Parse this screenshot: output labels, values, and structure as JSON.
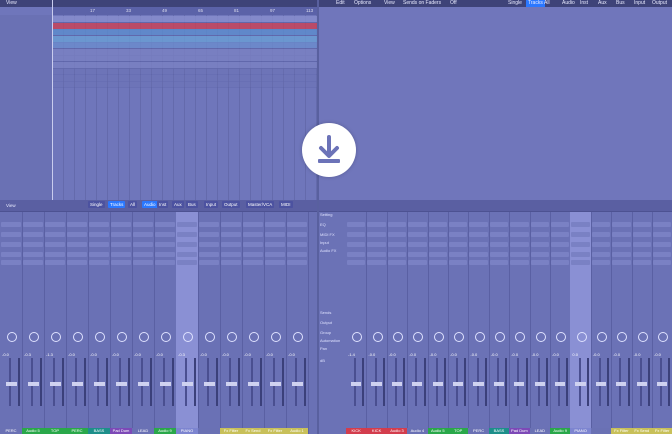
{
  "top_left": {
    "menu": {
      "view": "View"
    },
    "ruler": [
      "17",
      "33",
      "49",
      "65",
      "81",
      "97",
      "113"
    ],
    "track_rows": [
      {
        "color": "#8a90d0"
      },
      {
        "color": "#d33d4d"
      },
      {
        "color": "#5b8fd0"
      },
      {
        "color": "#6aa2d8"
      },
      {
        "color": "#6c8fd0"
      },
      {
        "color": "#7c83c4"
      },
      {
        "color": "#7c83c4"
      },
      {
        "color": "#7c83c4"
      },
      {
        "color": "#6a71b4"
      },
      {
        "color": "#6a71b4"
      },
      {
        "color": "#6a71b4"
      }
    ]
  },
  "top_right": {
    "menu": [
      "Edit",
      "Options",
      "View",
      "Sends on Faders",
      "Off"
    ],
    "filter": [
      "Single",
      "Tracks",
      "All",
      "Audio",
      "Inst",
      "Aux",
      "Bus",
      "Input",
      "Output"
    ]
  },
  "left_mixer": {
    "menu": {
      "view": "View"
    },
    "filter": [
      "Single",
      "Tracks",
      "All",
      "Audio",
      "Inst",
      "Aux",
      "Bus",
      "Input",
      "Output",
      "Master/VCA",
      "MIDI"
    ],
    "strips": [
      {
        "name": "PERC",
        "color": "#6a71b4",
        "sel": false,
        "fx": "Audio FX",
        "send": "-0.0"
      },
      {
        "name": "Audio 5",
        "color": "#2aa84a",
        "sel": false,
        "fx": "",
        "send": "-0.3"
      },
      {
        "name": "TOP",
        "color": "#2aa84a",
        "sel": false,
        "fx": "",
        "send": "-1.3"
      },
      {
        "name": "PERC",
        "color": "#2aa84a",
        "sel": false,
        "fx": "",
        "send": "-0.0"
      },
      {
        "name": "BASS",
        "color": "#1d8f8a",
        "sel": false,
        "fx": "",
        "send": "-0.0"
      },
      {
        "name": "Pad Dum",
        "color": "#7d49b7",
        "sel": false,
        "fx": "",
        "send": "-0.0"
      },
      {
        "name": "LEAD",
        "color": "#6a71b4",
        "sel": false,
        "fx": "",
        "send": "-0.0"
      },
      {
        "name": "Audio 9",
        "color": "#2aa84a",
        "sel": false,
        "fx": "",
        "send": "-0.0"
      },
      {
        "name": "PIANO",
        "color": "#7d85d0",
        "sel": true,
        "fx": "",
        "send": "-0.3"
      },
      {
        "name": "",
        "color": "#6a71b4",
        "sel": false,
        "fx": "",
        "send": "-0.0"
      },
      {
        "name": "Fx Filter",
        "color": "#c8c05a",
        "sel": false,
        "fx": "",
        "send": "-0.0"
      },
      {
        "name": "Fx Send",
        "color": "#c8c05a",
        "sel": false,
        "fx": "",
        "send": "-0.0"
      },
      {
        "name": "Fx Filter",
        "color": "#c8c05a",
        "sel": false,
        "fx": "",
        "send": "-0.0"
      },
      {
        "name": "Audio 1",
        "color": "#c8c05a",
        "sel": false,
        "fx": "",
        "send": "-0.0"
      }
    ]
  },
  "right_mixer": {
    "labels": [
      "Setting",
      "EQ",
      "MIDI FX",
      "Input",
      "Audio FX",
      "Sends",
      "Output",
      "Group",
      "Automation",
      "Pan",
      "dB"
    ],
    "strips": [
      {
        "name": "KICK",
        "color": "#d33d4d",
        "sel": false,
        "send": "-1.4"
      },
      {
        "name": "KICK",
        "color": "#d33d4d",
        "sel": false,
        "send": "-0.0"
      },
      {
        "name": "Audio 3",
        "color": "#d33d4d",
        "sel": false,
        "send": "-0.0"
      },
      {
        "name": "Audio 4",
        "color": "#6a71b4",
        "sel": false,
        "send": "-0.0"
      },
      {
        "name": "Audio 5",
        "color": "#2aa84a",
        "sel": false,
        "send": "-0.0"
      },
      {
        "name": "TOP",
        "color": "#2aa84a",
        "sel": false,
        "send": "-0.0"
      },
      {
        "name": "PERC",
        "color": "#6a71b4",
        "sel": false,
        "send": "-0.0"
      },
      {
        "name": "BASS",
        "color": "#1d8f8a",
        "sel": false,
        "send": "-0.0"
      },
      {
        "name": "Pad Dum",
        "color": "#7d49b7",
        "sel": false,
        "send": "-0.0"
      },
      {
        "name": "LEAD",
        "color": "#6a71b4",
        "sel": false,
        "send": "-0.0"
      },
      {
        "name": "Audio 9",
        "color": "#2aa84a",
        "sel": false,
        "send": "-0.0"
      },
      {
        "name": "PIANO",
        "color": "#7d85d0",
        "sel": true,
        "send": "0.0"
      },
      {
        "name": "",
        "color": "#6a71b4",
        "sel": false,
        "send": "-0.0"
      },
      {
        "name": "Fx Filter",
        "color": "#c8c05a",
        "sel": false,
        "send": "-0.0"
      },
      {
        "name": "Fx Send",
        "color": "#c8c05a",
        "sel": false,
        "send": "-0.0"
      },
      {
        "name": "Fx Filter",
        "color": "#c8c05a",
        "sel": false,
        "send": "-0.0"
      }
    ]
  },
  "overlay": {
    "icon": "download-icon"
  }
}
